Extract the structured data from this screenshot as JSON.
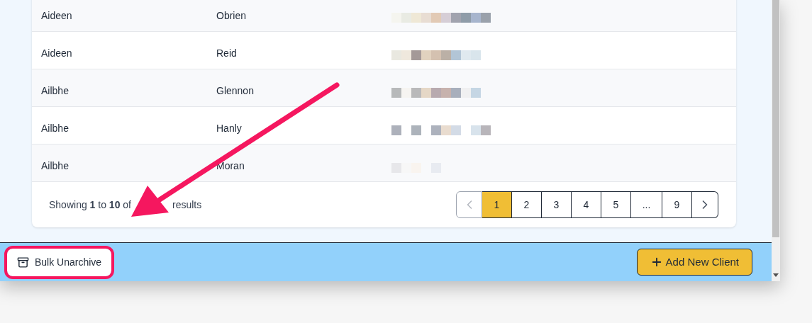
{
  "table": {
    "rows": [
      {
        "first_name": "Aideen",
        "last_name": "Obrien"
      },
      {
        "first_name": "Aideen",
        "last_name": "Reid"
      },
      {
        "first_name": "Ailbhe",
        "last_name": "Glennon"
      },
      {
        "first_name": "Ailbhe",
        "last_name": "Hanly"
      },
      {
        "first_name": "Ailbhe",
        "last_name": "Moran"
      }
    ]
  },
  "summary": {
    "text": "Showing **1** to **10** of",
    "tail": "results"
  },
  "pagination": {
    "prev": {
      "disabled": true
    },
    "next": {
      "disabled": false
    },
    "pages": [
      {
        "label": "1",
        "selected": true
      },
      {
        "label": "2",
        "selected": false
      },
      {
        "label": "3",
        "selected": false
      },
      {
        "label": "4",
        "selected": false
      },
      {
        "label": "5",
        "selected": false
      },
      {
        "label": "...",
        "selected": false
      },
      {
        "label": "9",
        "selected": false
      }
    ]
  },
  "bottom_bar": {
    "buttons": [
      {
        "label": "Bulk Unarchive",
        "kind": "secondary",
        "highlighted": true
      },
      {
        "label": "Add New Client",
        "kind": "primary"
      }
    ]
  }
}
